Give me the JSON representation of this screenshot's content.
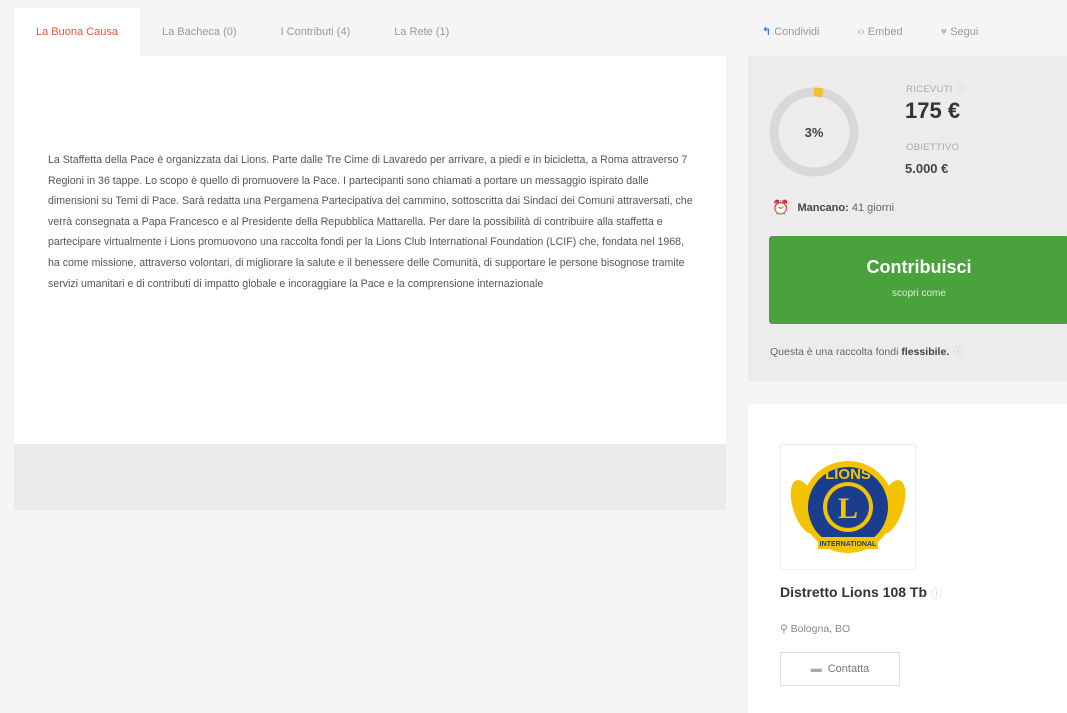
{
  "tabs": [
    {
      "label": "La Buona Causa",
      "active": true
    },
    {
      "label": "La Bacheca (0)"
    },
    {
      "label": "I Contributi (4)"
    },
    {
      "label": "La Rete (1)"
    }
  ],
  "actions": {
    "share": {
      "label": "Condividi",
      "icon": "share-icon"
    },
    "embed": {
      "label": "Embed",
      "icon": "code-icon"
    },
    "follow": {
      "label": "Segui",
      "icon": "heart-icon"
    }
  },
  "story": {
    "text": "La Staffetta della Pace è organizzata dai Lions. Parte dalle Tre Cime di Lavaredo per arrivare, a piedi e in bicicletta, a Roma attraverso 7 Regioni in 36 tappe. Lo scopo è quello di promuovere la Pace. I partecipanti sono chiamati a portare un messaggio ispirato dalle dimensioni su Temi di Pace. Sarà redatta una Pergamena Partecipativa del cammino, sottoscritta dai Sindaci dei Comuni attraversati, che verrà consegnata a Papa Francesco e al Presidente della Repubblica Mattarella. Per dare la possibilità di contribuire alla staffetta e partecipare virtualmente i Lions promuovono una raccolta fondi per la Lions Club International Foundation (LCIF) che, fondata nel 1968, ha come missione, attraverso volontari, di migliorare la salute e il benessere delle Comunità, di supportare le persone bisognose tramite servizi umanitari e di contributi di impatto globale e incoraggiare la Pace e la comprensione internazionale"
  },
  "funding": {
    "percent_label": "3%",
    "percent_value": 3.5,
    "raised_label": "RICEVUTI",
    "raised_value": "175 €",
    "goal_label": "OBIETTIVO",
    "goal_value": "5.000 €",
    "remaining_label": "Mancano:",
    "remaining_value": "41 giorni",
    "cta_label": "Contribuisci",
    "cta_sub": "scopri come",
    "flex_note_prefix": "Questa è una raccolta fondi",
    "flex_note_bold": "flessibile.",
    "colors": {
      "progress": "#f2c12e",
      "track": "#d8d8d8",
      "cta": "#4aa23d"
    }
  },
  "organizer": {
    "name": "Distretto Lions 108 Tb",
    "location": "Bologna, BO",
    "contact_label": "Contatta",
    "logo": {
      "top_text": "LIONS",
      "bottom_text": "INTERNATIONAL",
      "letter": "L"
    }
  }
}
